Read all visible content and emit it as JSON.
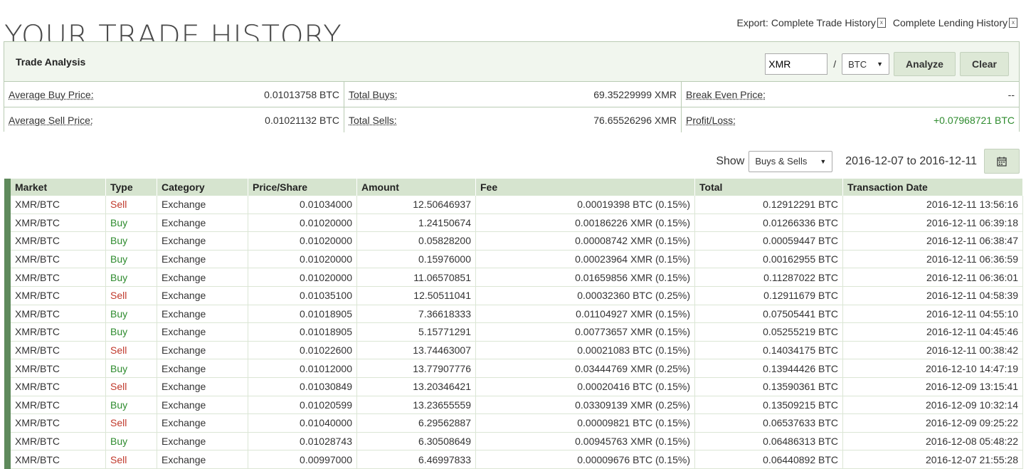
{
  "page": {
    "title": "YOUR TRADE HISTORY"
  },
  "export": {
    "label": "Export:",
    "links": [
      "Complete Trade History",
      "Complete Lending History"
    ],
    "icon": "xls-file-icon"
  },
  "analysis": {
    "title": "Trade Analysis",
    "coin_input": "XMR",
    "separator": "/",
    "base_select": "BTC",
    "analyze_button": "Analyze",
    "clear_button": "Clear",
    "rows": [
      [
        {
          "label": "Average Buy Price:",
          "value": "0.01013758 BTC"
        },
        {
          "label": "Total Buys:",
          "value": "69.35229999 XMR"
        },
        {
          "label": "Break Even Price:",
          "value": "--"
        }
      ],
      [
        {
          "label": "Average Sell Price:",
          "value": "0.01021132 BTC"
        },
        {
          "label": "Total Sells:",
          "value": "76.65526296 XMR"
        },
        {
          "label": "Profit/Loss:",
          "value": "+0.07968721 BTC"
        }
      ]
    ]
  },
  "filter": {
    "show_label": "Show",
    "show_select": "Buys & Sells",
    "date_range": "2016-12-07 to 2016-12-11",
    "calendar_icon": "calendar-icon"
  },
  "table": {
    "headers": [
      "Market",
      "Type",
      "Category",
      "Price/Share",
      "Amount",
      "Fee",
      "Total",
      "Transaction Date"
    ],
    "rows": [
      [
        "XMR/BTC",
        "Sell",
        "Exchange",
        "0.01034000",
        "12.50646937",
        "0.00019398 BTC (0.15%)",
        "0.12912291 BTC",
        "2016-12-11 13:56:16"
      ],
      [
        "XMR/BTC",
        "Buy",
        "Exchange",
        "0.01020000",
        "1.24150674",
        "0.00186226 XMR (0.15%)",
        "0.01266336 BTC",
        "2016-12-11 06:39:18"
      ],
      [
        "XMR/BTC",
        "Buy",
        "Exchange",
        "0.01020000",
        "0.05828200",
        "0.00008742 XMR (0.15%)",
        "0.00059447 BTC",
        "2016-12-11 06:38:47"
      ],
      [
        "XMR/BTC",
        "Buy",
        "Exchange",
        "0.01020000",
        "0.15976000",
        "0.00023964 XMR (0.15%)",
        "0.00162955 BTC",
        "2016-12-11 06:36:59"
      ],
      [
        "XMR/BTC",
        "Buy",
        "Exchange",
        "0.01020000",
        "11.06570851",
        "0.01659856 XMR (0.15%)",
        "0.11287022 BTC",
        "2016-12-11 06:36:01"
      ],
      [
        "XMR/BTC",
        "Sell",
        "Exchange",
        "0.01035100",
        "12.50511041",
        "0.00032360 BTC (0.25%)",
        "0.12911679 BTC",
        "2016-12-11 04:58:39"
      ],
      [
        "XMR/BTC",
        "Buy",
        "Exchange",
        "0.01018905",
        "7.36618333",
        "0.01104927 XMR (0.15%)",
        "0.07505441 BTC",
        "2016-12-11 04:55:10"
      ],
      [
        "XMR/BTC",
        "Buy",
        "Exchange",
        "0.01018905",
        "5.15771291",
        "0.00773657 XMR (0.15%)",
        "0.05255219 BTC",
        "2016-12-11 04:45:46"
      ],
      [
        "XMR/BTC",
        "Sell",
        "Exchange",
        "0.01022600",
        "13.74463007",
        "0.00021083 BTC (0.15%)",
        "0.14034175 BTC",
        "2016-12-11 00:38:42"
      ],
      [
        "XMR/BTC",
        "Buy",
        "Exchange",
        "0.01012000",
        "13.77907776",
        "0.03444769 XMR (0.25%)",
        "0.13944426 BTC",
        "2016-12-10 14:47:19"
      ],
      [
        "XMR/BTC",
        "Sell",
        "Exchange",
        "0.01030849",
        "13.20346421",
        "0.00020416 BTC (0.15%)",
        "0.13590361 BTC",
        "2016-12-09 13:15:41"
      ],
      [
        "XMR/BTC",
        "Buy",
        "Exchange",
        "0.01020599",
        "13.23655559",
        "0.03309139 XMR (0.25%)",
        "0.13509215 BTC",
        "2016-12-09 10:32:14"
      ],
      [
        "XMR/BTC",
        "Sell",
        "Exchange",
        "0.01040000",
        "6.29562887",
        "0.00009821 BTC (0.15%)",
        "0.06537633 BTC",
        "2016-12-09 09:25:22"
      ],
      [
        "XMR/BTC",
        "Buy",
        "Exchange",
        "0.01028743",
        "6.30508649",
        "0.00945763 XMR (0.15%)",
        "0.06486313 BTC",
        "2016-12-08 05:48:22"
      ],
      [
        "XMR/BTC",
        "Sell",
        "Exchange",
        "0.00997000",
        "6.46997833",
        "0.00009676 BTC (0.15%)",
        "0.06440892 BTC",
        "2016-12-07 21:55:28"
      ]
    ]
  },
  "colors": {
    "buy": "#2e8b2e",
    "sell": "#c0392b",
    "header_bg": "#d6e4cf",
    "accent_bar": "#5f8a5c"
  }
}
